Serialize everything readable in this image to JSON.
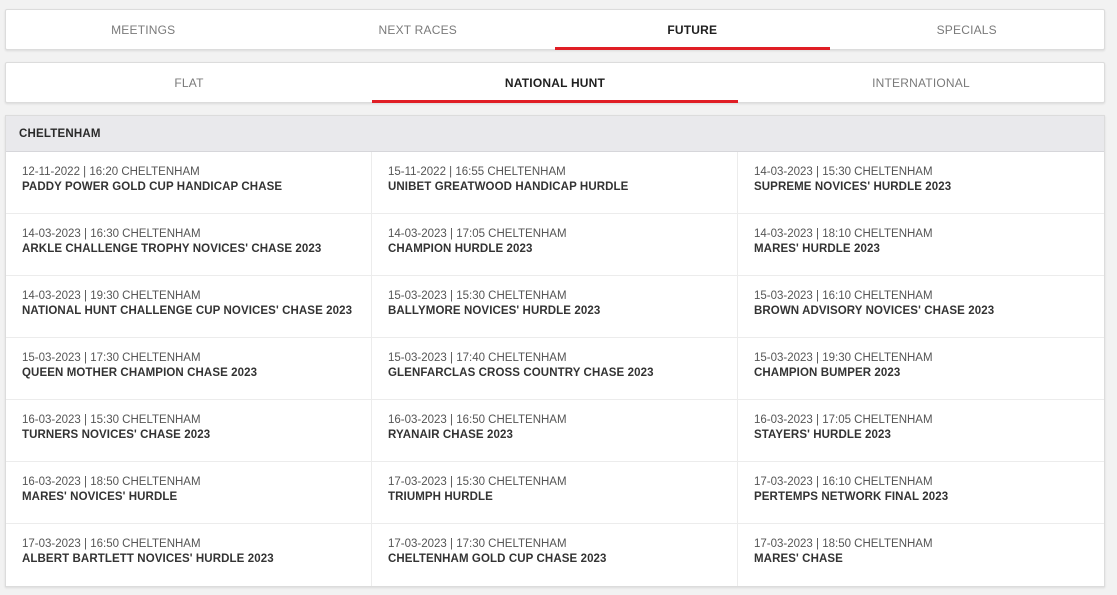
{
  "top_tabs": [
    {
      "label": "MEETINGS",
      "active": false
    },
    {
      "label": "NEXT RACES",
      "active": false
    },
    {
      "label": "FUTURE",
      "active": true
    },
    {
      "label": "SPECIALS",
      "active": false
    }
  ],
  "sub_tabs": [
    {
      "label": "FLAT",
      "active": false
    },
    {
      "label": "NATIONAL HUNT",
      "active": true
    },
    {
      "label": "INTERNATIONAL",
      "active": false
    }
  ],
  "accent_color": "#e01e25",
  "section": {
    "title": "CHELTENHAM",
    "races": [
      {
        "meta": "12-11-2022 | 16:20 CHELTENHAM",
        "name": "PADDY POWER GOLD CUP HANDICAP CHASE"
      },
      {
        "meta": "15-11-2022 | 16:55 CHELTENHAM",
        "name": "UNIBET GREATWOOD HANDICAP HURDLE"
      },
      {
        "meta": "14-03-2023 | 15:30 CHELTENHAM",
        "name": "SUPREME NOVICES' HURDLE 2023"
      },
      {
        "meta": "14-03-2023 | 16:30 CHELTENHAM",
        "name": "ARKLE CHALLENGE TROPHY NOVICES' CHASE 2023"
      },
      {
        "meta": "14-03-2023 | 17:05 CHELTENHAM",
        "name": "CHAMPION HURDLE 2023"
      },
      {
        "meta": "14-03-2023 | 18:10 CHELTENHAM",
        "name": "MARES' HURDLE 2023"
      },
      {
        "meta": "14-03-2023 | 19:30 CHELTENHAM",
        "name": "NATIONAL HUNT CHALLENGE CUP NOVICES' CHASE 2023"
      },
      {
        "meta": "15-03-2023 | 15:30 CHELTENHAM",
        "name": "BALLYMORE NOVICES' HURDLE 2023"
      },
      {
        "meta": "15-03-2023 | 16:10 CHELTENHAM",
        "name": "BROWN ADVISORY NOVICES' CHASE 2023"
      },
      {
        "meta": "15-03-2023 | 17:30 CHELTENHAM",
        "name": "QUEEN MOTHER CHAMPION CHASE 2023"
      },
      {
        "meta": "15-03-2023 | 17:40 CHELTENHAM",
        "name": "GLENFARCLAS CROSS COUNTRY CHASE 2023"
      },
      {
        "meta": "15-03-2023 | 19:30 CHELTENHAM",
        "name": "CHAMPION BUMPER 2023"
      },
      {
        "meta": "16-03-2023 | 15:30 CHELTENHAM",
        "name": "TURNERS NOVICES' CHASE 2023"
      },
      {
        "meta": "16-03-2023 | 16:50 CHELTENHAM",
        "name": "RYANAIR CHASE 2023"
      },
      {
        "meta": "16-03-2023 | 17:05 CHELTENHAM",
        "name": "STAYERS' HURDLE 2023"
      },
      {
        "meta": "16-03-2023 | 18:50 CHELTENHAM",
        "name": "MARES' NOVICES' HURDLE"
      },
      {
        "meta": "17-03-2023 | 15:30 CHELTENHAM",
        "name": "TRIUMPH HURDLE"
      },
      {
        "meta": "17-03-2023 | 16:10 CHELTENHAM",
        "name": "PERTEMPS NETWORK FINAL 2023"
      },
      {
        "meta": "17-03-2023 | 16:50 CHELTENHAM",
        "name": "ALBERT BARTLETT NOVICES' HURDLE 2023"
      },
      {
        "meta": "17-03-2023 | 17:30 CHELTENHAM",
        "name": "CHELTENHAM GOLD CUP CHASE 2023"
      },
      {
        "meta": "17-03-2023 | 18:50 CHELTENHAM",
        "name": "MARES' CHASE"
      }
    ]
  }
}
